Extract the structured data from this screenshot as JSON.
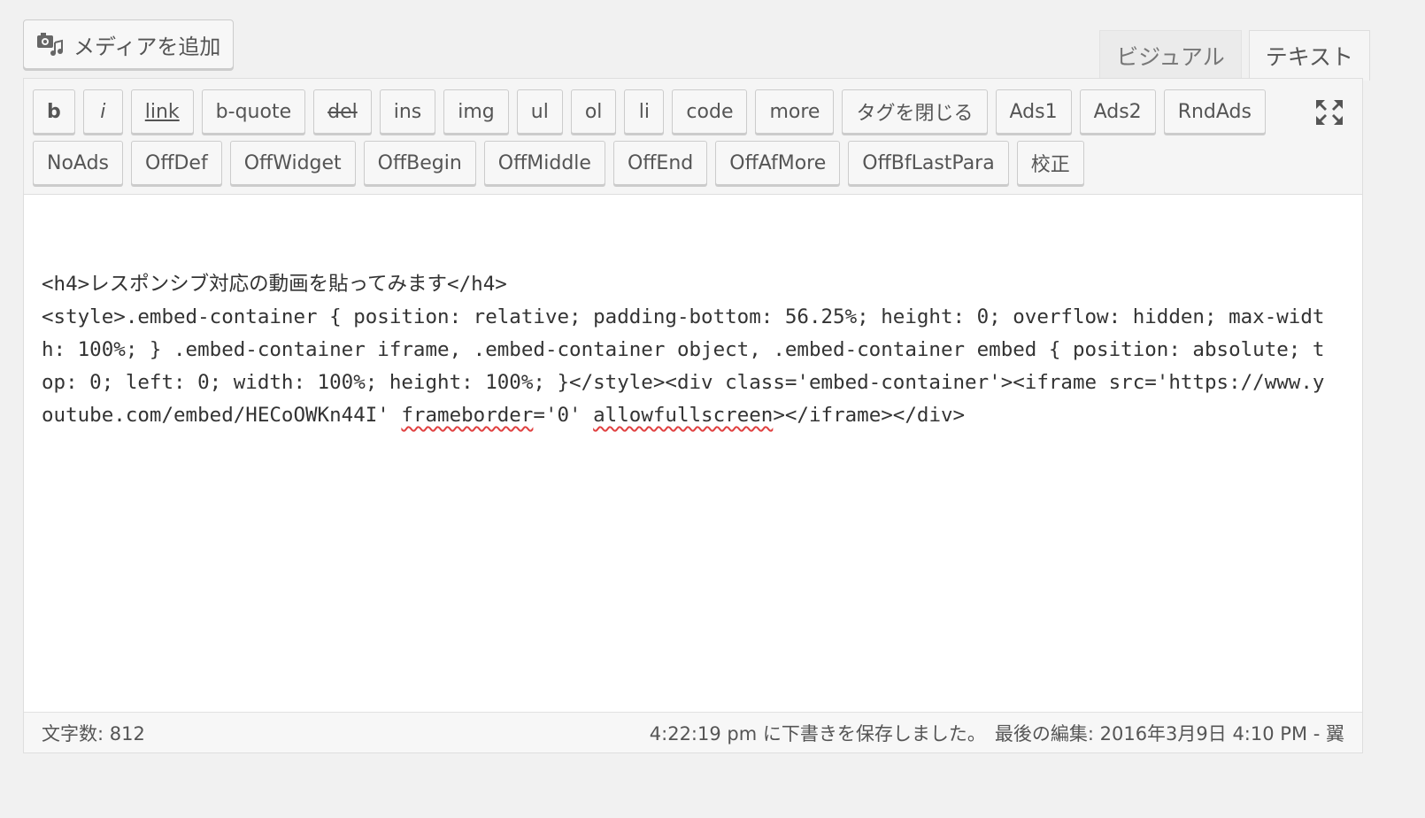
{
  "media": {
    "label": "メディアを追加",
    "icon": "camera-music-icon"
  },
  "tabs": [
    {
      "label": "ビジュアル",
      "active": false
    },
    {
      "label": "テキスト",
      "active": true
    }
  ],
  "toolbar": {
    "row1": [
      {
        "label": "b",
        "name": "qt-b",
        "style": "bold"
      },
      {
        "label": "i",
        "name": "qt-i",
        "style": "ital"
      },
      {
        "label": "link",
        "name": "qt-link",
        "style": "under"
      },
      {
        "label": "b-quote",
        "name": "qt-b-quote",
        "style": ""
      },
      {
        "label": "del",
        "name": "qt-del",
        "style": "strike"
      },
      {
        "label": "ins",
        "name": "qt-ins",
        "style": ""
      },
      {
        "label": "img",
        "name": "qt-img",
        "style": ""
      },
      {
        "label": "ul",
        "name": "qt-ul",
        "style": ""
      },
      {
        "label": "ol",
        "name": "qt-ol",
        "style": ""
      },
      {
        "label": "li",
        "name": "qt-li",
        "style": ""
      },
      {
        "label": "code",
        "name": "qt-code",
        "style": ""
      },
      {
        "label": "more",
        "name": "qt-more",
        "style": ""
      },
      {
        "label": "タグを閉じる",
        "name": "qt-close-tags",
        "style": ""
      },
      {
        "label": "Ads1",
        "name": "qt-ads1",
        "style": ""
      },
      {
        "label": "Ads2",
        "name": "qt-ads2",
        "style": ""
      },
      {
        "label": "RndAds",
        "name": "qt-rndads",
        "style": ""
      }
    ],
    "row2": [
      {
        "label": "NoAds",
        "name": "qt-noads",
        "style": ""
      },
      {
        "label": "OffDef",
        "name": "qt-offdef",
        "style": ""
      },
      {
        "label": "OffWidget",
        "name": "qt-offwidget",
        "style": ""
      },
      {
        "label": "OffBegin",
        "name": "qt-offbegin",
        "style": ""
      },
      {
        "label": "OffMiddle",
        "name": "qt-offmiddle",
        "style": ""
      },
      {
        "label": "OffEnd",
        "name": "qt-offend",
        "style": ""
      },
      {
        "label": "OffAfMore",
        "name": "qt-offafmore",
        "style": ""
      },
      {
        "label": "OffBfLastPara",
        "name": "qt-offbflastpara",
        "style": ""
      },
      {
        "label": "校正",
        "name": "qt-proofread",
        "style": ""
      }
    ],
    "fullscreen_icon": "fullscreen-icon"
  },
  "content": {
    "segments": [
      {
        "text": "<h4>レスポンシブ対応の動画を貼ってみます</h4>\n<style>.embed-container { position: relative; padding-bottom: 56.25%; height: 0; overflow: hidden; max-width: 100%; } .embed-container iframe, .embed-container object, .embed-container embed { position: absolute; top: 0; left: 0; width: 100%; height: 100%; }</style><div class='embed-container'><iframe src='https://www.youtube.com/embed/HECoOWKn44I' ",
        "spell": false
      },
      {
        "text": "frameborder",
        "spell": true
      },
      {
        "text": "='0' ",
        "spell": false
      },
      {
        "text": "allowfullscreen",
        "spell": true
      },
      {
        "text": "></iframe></div>",
        "spell": false
      }
    ]
  },
  "status": {
    "word_count": "文字数: 812",
    "autosave": "4:22:19 pm に下書きを保存しました。",
    "last_edit": "最後の編集: 2016年3月9日 4:10 PM - 翼"
  },
  "colors": {
    "spellcheck": "#e04040",
    "editor_bg": "#ffffff",
    "toolbar_bg": "#f5f5f5"
  }
}
